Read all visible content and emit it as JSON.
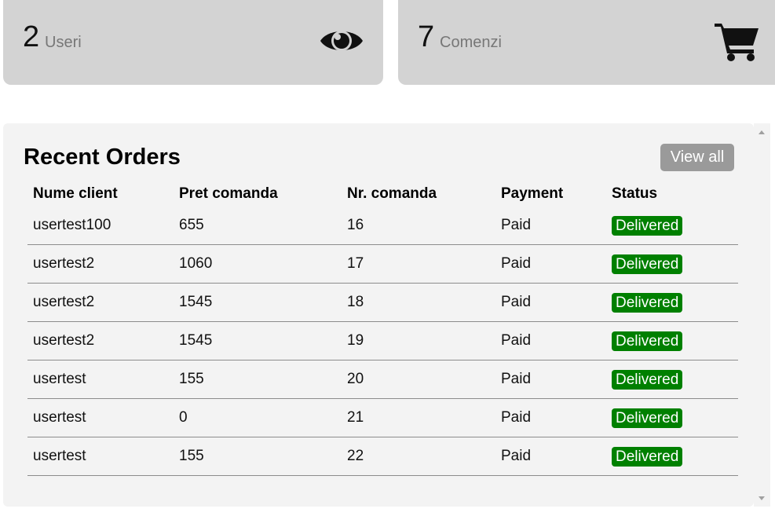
{
  "stats": {
    "users": {
      "count": "2",
      "label": "Useri",
      "icon": "eye-icon"
    },
    "orders": {
      "count": "7",
      "label": "Comenzi",
      "icon": "cart-icon"
    }
  },
  "recent_orders": {
    "title": "Recent Orders",
    "view_all_label": "View all",
    "columns": [
      "Nume client",
      "Pret comanda",
      "Nr. comanda",
      "Payment",
      "Status"
    ],
    "rows": [
      {
        "client": "usertest100",
        "price": "655",
        "nr": "16",
        "payment": "Paid",
        "status": "Delivered"
      },
      {
        "client": "usertest2",
        "price": "1060",
        "nr": "17",
        "payment": "Paid",
        "status": "Delivered"
      },
      {
        "client": "usertest2",
        "price": "1545",
        "nr": "18",
        "payment": "Paid",
        "status": "Delivered"
      },
      {
        "client": "usertest2",
        "price": "1545",
        "nr": "19",
        "payment": "Paid",
        "status": "Delivered"
      },
      {
        "client": "usertest",
        "price": "155",
        "nr": "20",
        "payment": "Paid",
        "status": "Delivered"
      },
      {
        "client": "usertest",
        "price": "0",
        "nr": "21",
        "payment": "Paid",
        "status": "Delivered"
      },
      {
        "client": "usertest",
        "price": "155",
        "nr": "22",
        "payment": "Paid",
        "status": "Delivered"
      }
    ]
  },
  "colors": {
    "card_bg": "#d3d3d3",
    "panel_bg": "#f3f3f3",
    "status_delivered": "#008000",
    "button_bg": "#9a9a9a"
  }
}
